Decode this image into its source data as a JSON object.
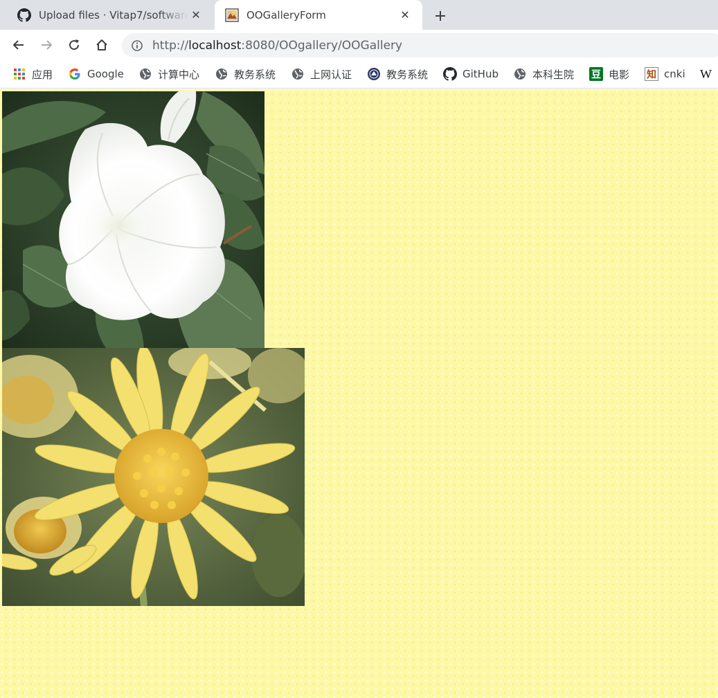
{
  "tabs": [
    {
      "title": "Upload files · Vitap7/software_",
      "favicon": "github-icon",
      "active": false
    },
    {
      "title": "OOGalleryForm",
      "favicon": "gallery-icon",
      "active": true
    }
  ],
  "toolbar": {
    "url_scheme": "http://",
    "url_host": "localhost",
    "url_rest": ":8080/OOgallery/OOGallery"
  },
  "bookmarks": [
    {
      "label": "应用",
      "icon": "apps-grid-icon"
    },
    {
      "label": "Google",
      "icon": "google-icon"
    },
    {
      "label": "计算中心",
      "icon": "globe-icon"
    },
    {
      "label": "教务系统",
      "icon": "globe-icon"
    },
    {
      "label": "上网认证",
      "icon": "globe-icon"
    },
    {
      "label": "教务系统",
      "icon": "university-icon"
    },
    {
      "label": "GitHub",
      "icon": "github-icon"
    },
    {
      "label": "本科生院",
      "icon": "globe-icon"
    },
    {
      "label": "电影",
      "icon": "douban-icon"
    },
    {
      "label": "cnki",
      "icon": "cnki-icon"
    },
    {
      "label": "W",
      "icon": "wikipedia-icon"
    }
  ],
  "gallery": {
    "images": [
      {
        "subject": "white-morning-glory-photo"
      },
      {
        "subject": "yellow-daisy-photo"
      }
    ]
  },
  "colors": {
    "page_background": "#fdf8a6",
    "tabstrip": "#dee1e6",
    "omnibox": "#f1f3f4"
  }
}
